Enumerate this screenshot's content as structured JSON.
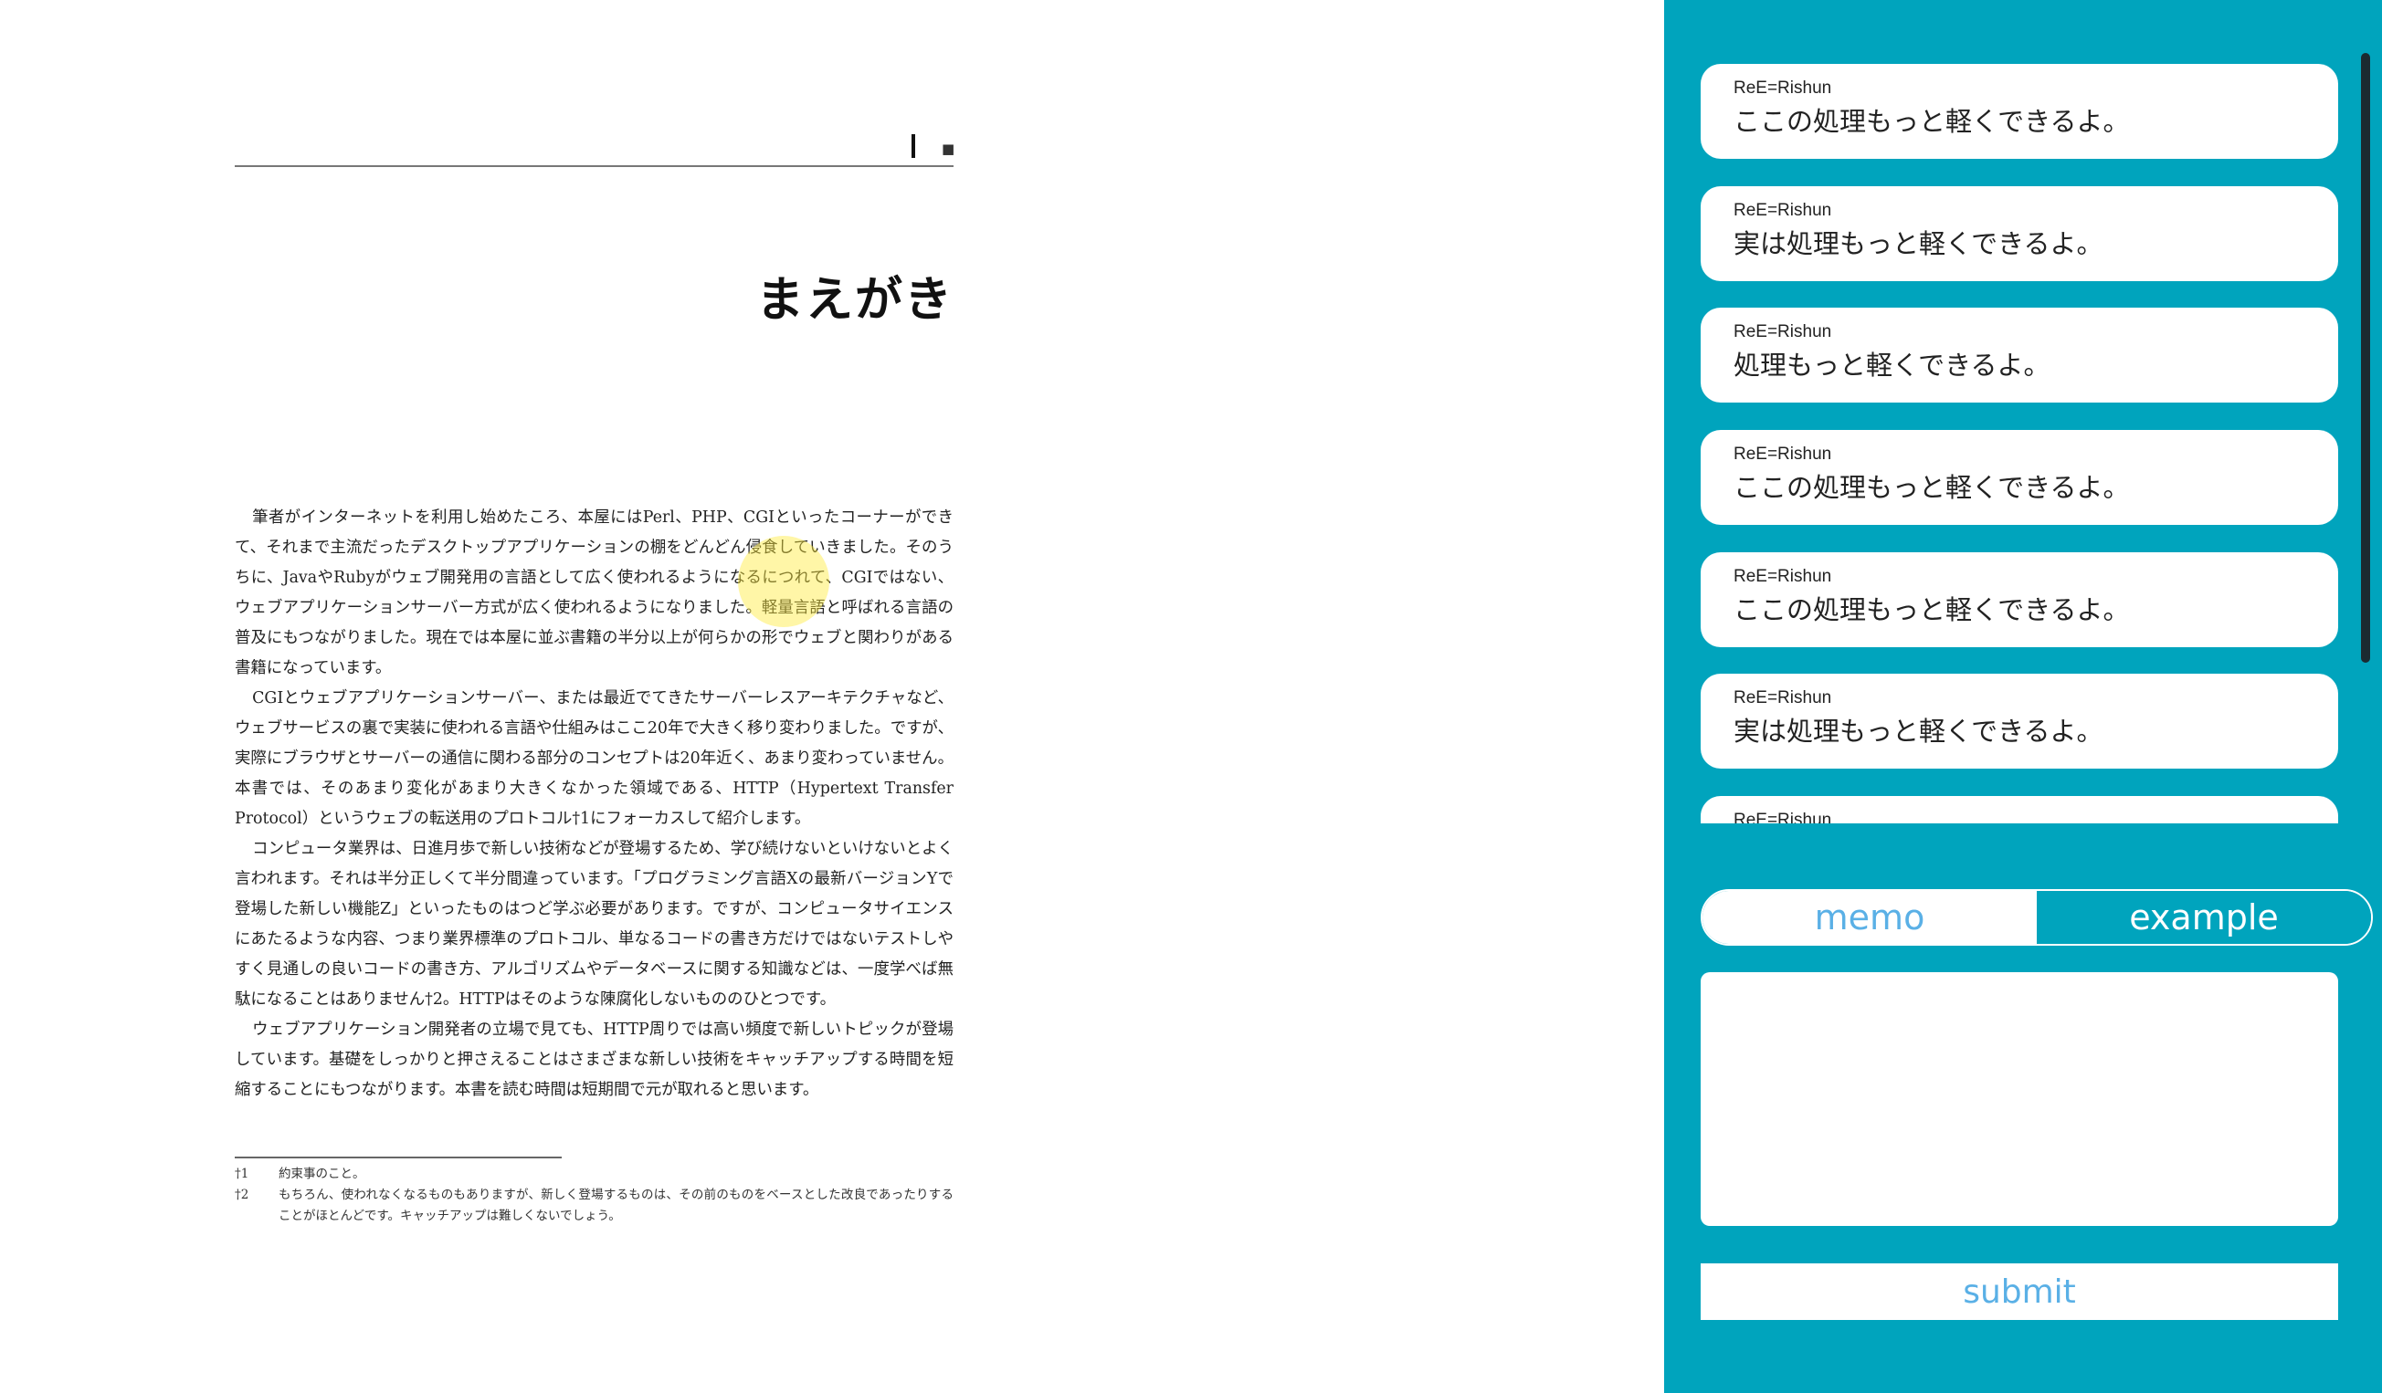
{
  "document": {
    "header_icon": "■",
    "title": "まえがき",
    "paragraphs": [
      "筆者がインターネットを利用し始めたころ、本屋にはPerl、PHP、CGIといったコーナーができて、それまで主流だったデスクトップアプリケーションの棚をどんどん侵食していきました。そのうちに、JavaやRubyがウェブ開発用の言語として広く使われるようになるにつれて、CGIではない、ウェブアプリケーションサーバー方式が広く使われるようになりました。軽量言語と呼ばれる言語の普及にもつながりました。現在では本屋に並ぶ書籍の半分以上が何らかの形でウェブと関わりがある書籍になっています。",
      "CGIとウェブアプリケーションサーバー、または最近でてきたサーバーレスアーキテクチャなど、ウェブサービスの裏で実装に使われる言語や仕組みはここ20年で大きく移り変わりました。ですが、実際にブラウザとサーバーの通信に関わる部分のコンセプトは20年近く、あまり変わっていません。本書では、そのあまり変化があまり大きくなかった領域である、HTTP（Hypertext Transfer Protocol）というウェブの転送用のプロトコル†1にフォーカスして紹介します。",
      "コンピュータ業界は、日進月歩で新しい技術などが登場するため、学び続けないといけないとよく言われます。それは半分正しくて半分間違っています。「プログラミング言語Xの最新バージョンYで登場した新しい機能Z」といったものはつど学ぶ必要があります。ですが、コンピュータサイエンスにあたるような内容、つまり業界標準のプロトコル、単なるコードの書き方だけではないテストしやすく見通しの良いコードの書き方、アルゴリズムやデータベースに関する知識などは、一度学べば無駄になることはありません†2。HTTPはそのような陳腐化しないもののひとつです。",
      "ウェブアプリケーション開発者の立場で見ても、HTTP周りでは高い頻度で新しいトピックが登場しています。基礎をしっかりと押さえることはさまざまな新しい技術をキャッチアップする時間を短縮することにもつながります。本書を読む時間は短期間で元が取れると思います。"
    ],
    "footnotes": [
      {
        "mark": "†1",
        "text": "約束事のこと。"
      },
      {
        "mark": "†2",
        "text": "もちろん、使われなくなるものもありますが、新しく登場するものは、その前のものをベースとした改良であったりすることがほとんどです。キャッチアップは難しくないでしょう。"
      }
    ]
  },
  "comments": [
    {
      "user": "ReE=Rishun",
      "text": "ここの処理もっと軽くできるよ。"
    },
    {
      "user": "ReE=Rishun",
      "text": "実は処理もっと軽くできるよ。"
    },
    {
      "user": "ReE=Rishun",
      "text": "処理もっと軽くできるよ。"
    },
    {
      "user": "ReE=Rishun",
      "text": "ここの処理もっと軽くできるよ。"
    },
    {
      "user": "ReE=Rishun",
      "text": "ここの処理もっと軽くできるよ。"
    },
    {
      "user": "ReE=Rishun",
      "text": "実は処理もっと軽くできるよ。"
    },
    {
      "user": "ReE=Rishun",
      "text": ""
    }
  ],
  "tabs": {
    "memo": "memo",
    "example": "example"
  },
  "submit_label": "submit",
  "colors": {
    "panel": "#00a4bd",
    "accent_text": "#5ab0e6"
  }
}
